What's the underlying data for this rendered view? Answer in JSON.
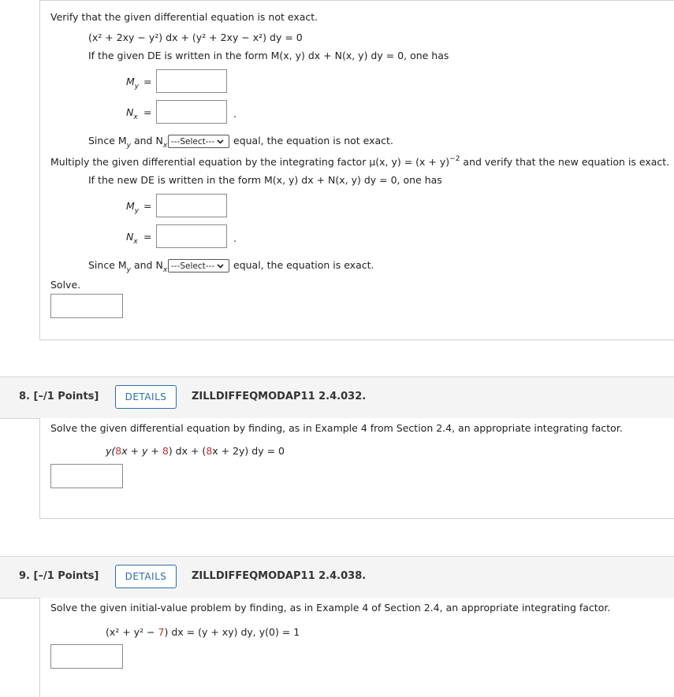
{
  "q7": {
    "verify_text": "Verify that the given differential equation is not exact.",
    "equation": "(x² + 2xy − y²) dx + (y² + 2xy − x²) dy = 0",
    "form_text_1": "If the given DE is written in the form M(x, y) dx + N(x, y) dy = 0, one has",
    "My_label": "M",
    "My_sub": "y",
    "Nx_label": "N",
    "Nx_sub": "x",
    "eq_sign": "=",
    "period": ".",
    "since_prefix": "Since M",
    "since_and": "and N",
    "select_label": "---Select---",
    "since_suffix_1": "equal, the equation is not exact.",
    "multiply_text": "Multiply the given differential equation by the integrating factor μ(x, y) = (x + y)",
    "multiply_exp": "−2",
    "multiply_suffix": "and verify that the new equation is exact.",
    "form_text_2": "If the new DE is written in the form M(x, y) dx + N(x, y) dy = 0, one has",
    "since_suffix_2": "equal, the equation is exact.",
    "solve_label": "Solve."
  },
  "q8": {
    "points": "8.  [–/1 Points]",
    "details": "DETAILS",
    "code": "ZILLDIFFEQMODAP11 2.4.032.",
    "prompt": "Solve the given differential equation by finding, as in Example 4 from Section 2.4, an appropriate integrating factor.",
    "eq_a": "y(",
    "eq_b": "8",
    "eq_c": "x + y + ",
    "eq_d": "8",
    "eq_e": ") dx + (",
    "eq_f": "8",
    "eq_g": "x + 2y) dy = 0"
  },
  "q9": {
    "points": "9.  [–/1 Points]",
    "details": "DETAILS",
    "code": "ZILLDIFFEQMODAP11 2.4.038.",
    "prompt": "Solve the given initial-value problem by finding, as in Example 4 of Section 2.4, an appropriate integrating factor.",
    "eq_a": "(x² + y² − ",
    "eq_b": "7",
    "eq_c": ") dx = (y + xy) dy,    y(0) = 1"
  }
}
